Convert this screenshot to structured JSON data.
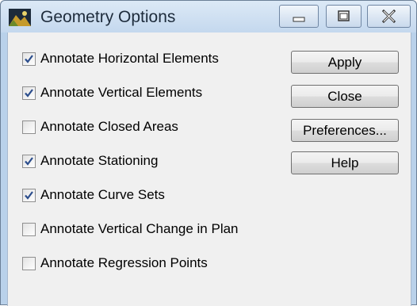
{
  "window": {
    "title": "Geometry Options",
    "controls": {
      "minimize": "minimize-icon",
      "maximize": "maximize-icon",
      "close": "close-icon"
    }
  },
  "options": [
    {
      "label": "Annotate Horizontal Elements",
      "checked": true
    },
    {
      "label": "Annotate Vertical Elements",
      "checked": true
    },
    {
      "label": "Annotate Closed Areas",
      "checked": false
    },
    {
      "label": "Annotate Stationing",
      "checked": true
    },
    {
      "label": "Annotate Curve Sets",
      "checked": true
    },
    {
      "label": "Annotate Vertical Change in Plan",
      "checked": false
    },
    {
      "label": "Annotate Regression Points",
      "checked": false
    }
  ],
  "buttons": {
    "apply": "Apply",
    "close": "Close",
    "preferences": "Preferences...",
    "help": "Help"
  },
  "colors": {
    "checkmark": "#2b4d8c",
    "title_bar": "#c4d8ee",
    "client_bg": "#f0f0f0"
  }
}
